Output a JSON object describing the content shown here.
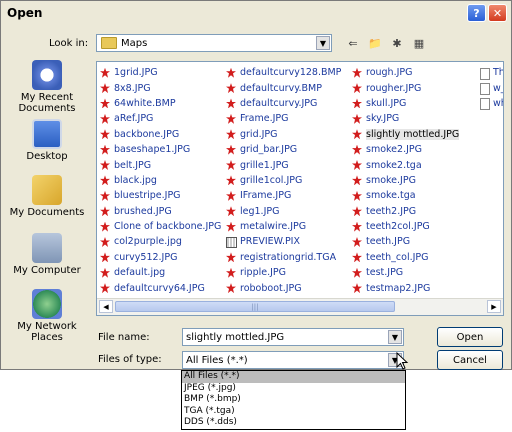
{
  "title": "Open",
  "lookin": {
    "label": "Look in:",
    "value": "Maps"
  },
  "toolbar": {
    "icons": [
      "back-arrow-icon",
      "up-folder-icon",
      "new-folder-icon",
      "view-menu-icon"
    ]
  },
  "places": [
    {
      "label": "My Recent Documents",
      "icon": "recent-documents-icon"
    },
    {
      "label": "Desktop",
      "icon": "desktop-icon"
    },
    {
      "label": "My Documents",
      "icon": "my-documents-icon"
    },
    {
      "label": "My Computer",
      "icon": "my-computer-icon"
    },
    {
      "label": "My Network Places",
      "icon": "network-places-icon"
    }
  ],
  "files": {
    "col1": [
      "1grid.JPG",
      "8x8.JPG",
      "64white.BMP",
      "aRef.JPG",
      "backbone.JPG",
      "baseshape1.JPG",
      "belt.JPG",
      "black.jpg",
      "bluestripe.JPG",
      "brushed.JPG",
      "Clone of backbone.JPG",
      "col2purple.jpg",
      "curvy512.JPG",
      "default.jpg",
      "defaultcurvy64.JPG"
    ],
    "col2": [
      "defaultcurvy128.BMP",
      "defaultcurvy.BMP",
      "defaultcurvy.JPG",
      "Frame.JPG",
      "grid.JPG",
      "grid_bar.JPG",
      "grille1.JPG",
      "grille1col.JPG",
      "IFrame.JPG",
      "leg1.JPG",
      "metalwire.JPG",
      "PREVIEW.PIX",
      "registrationgrid.TGA",
      "ripple.JPG",
      "roboboot.JPG"
    ],
    "col3": [
      "rough.JPG",
      "rougher.JPG",
      "skull.JPG",
      "sky.JPG",
      "slightly mottled.JPG",
      "smoke2.JPG",
      "smoke2.tga",
      "smoke.JPG",
      "smoke.tga",
      "teeth2.JPG",
      "teeth2col.JPG",
      "teeth.JPG",
      "teeth_col.JPG",
      "test.JPG",
      "testmap2.JPG"
    ],
    "col4": [
      "Th",
      "w_",
      "wh"
    ],
    "selected": "slightly mottled.JPG"
  },
  "filename": {
    "label": "File name:",
    "value": "slightly mottled.JPG"
  },
  "filetype": {
    "label": "Files of type:",
    "value": "All Files (*.*)",
    "options": [
      "All Files (*.*)",
      "JPEG (*.jpg)",
      "BMP (*.bmp)",
      "TGA (*.tga)",
      "DDS (*.dds)"
    ]
  },
  "buttons": {
    "open": "Open",
    "cancel": "Cancel"
  },
  "colors": {
    "file_text": "#1c3a9e",
    "file_icon": "#d21d1d",
    "dialog_bg": "#ece9d8"
  }
}
